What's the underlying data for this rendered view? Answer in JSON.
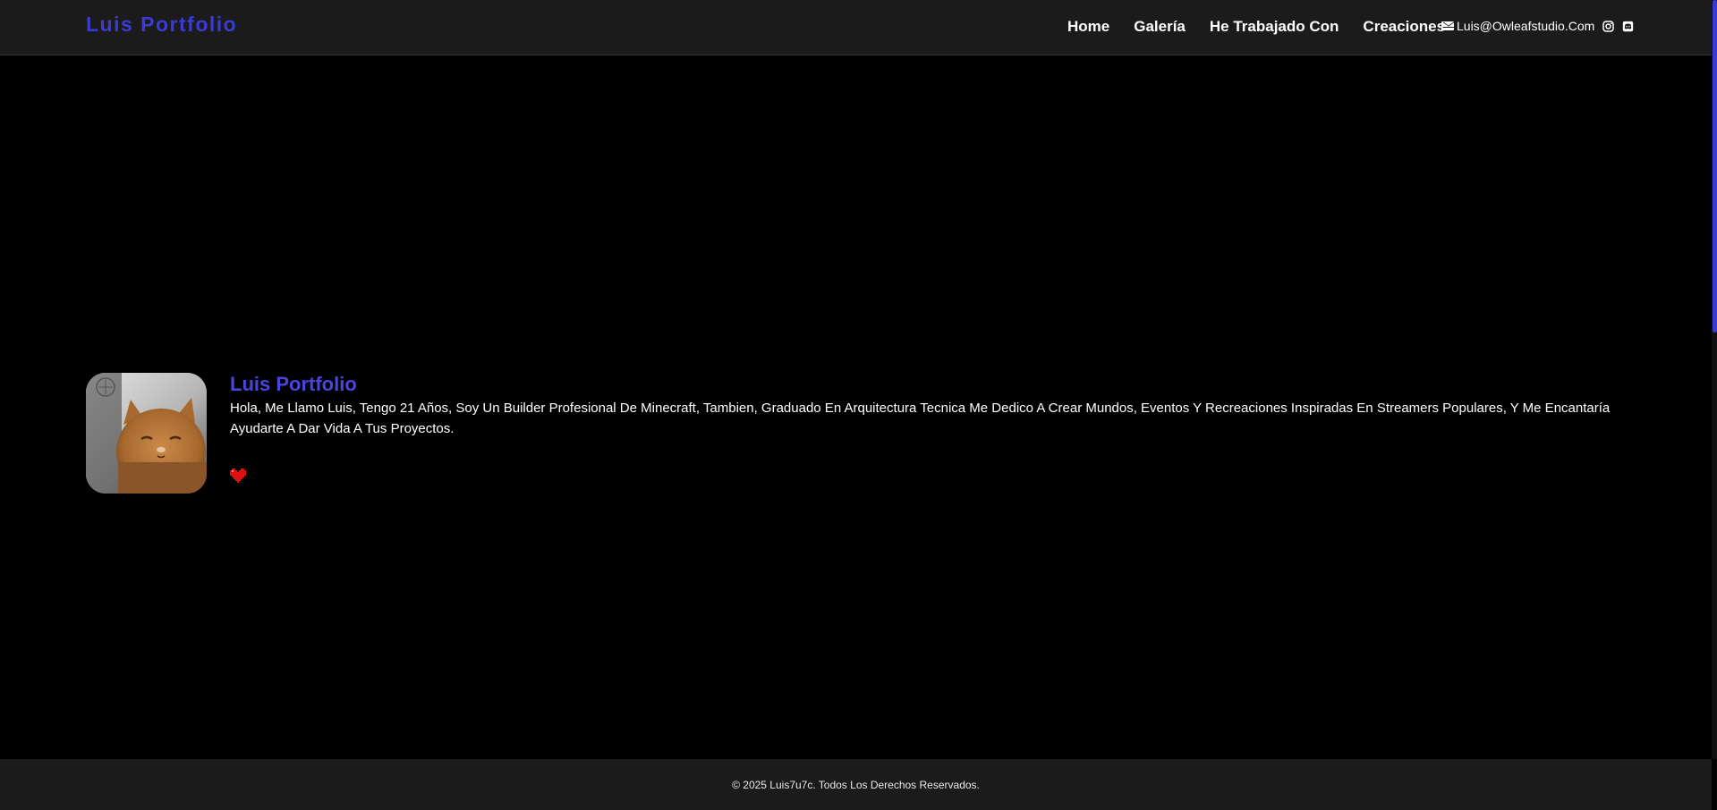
{
  "header": {
    "brand": "Luis Portfolio",
    "nav": [
      {
        "label": "Home"
      },
      {
        "label": "Galería"
      },
      {
        "label": "He Trabajado Con"
      },
      {
        "label": "Creaciones"
      }
    ],
    "email": "Luis@Owleafstudio.Com",
    "social_icons": [
      "instagram-icon",
      "discord-icon"
    ]
  },
  "profile": {
    "title": "Luis Portfolio",
    "description": "Hola, Me Llamo Luis, Tengo 21 Años, Soy Un Builder Profesional De Minecraft, Tambien, Graduado En Arquitectura Tecnica Me Dedico A Crear Mundos, Eventos Y Recreaciones Inspiradas En Streamers Populares, Y Me Encantaría Ayudarte A Dar Vida A Tus Proyectos.",
    "avatar_icon": "cat-avatar-image",
    "heart_icon": "pixel-heart-icon"
  },
  "footer": {
    "copyright": "© 2025 Luis7u7c. Todos Los Derechos Reservados."
  },
  "colors": {
    "accent": "#3a3ad6",
    "background": "#000000",
    "bar": "#1b1b1b",
    "heart": "#e01010"
  }
}
